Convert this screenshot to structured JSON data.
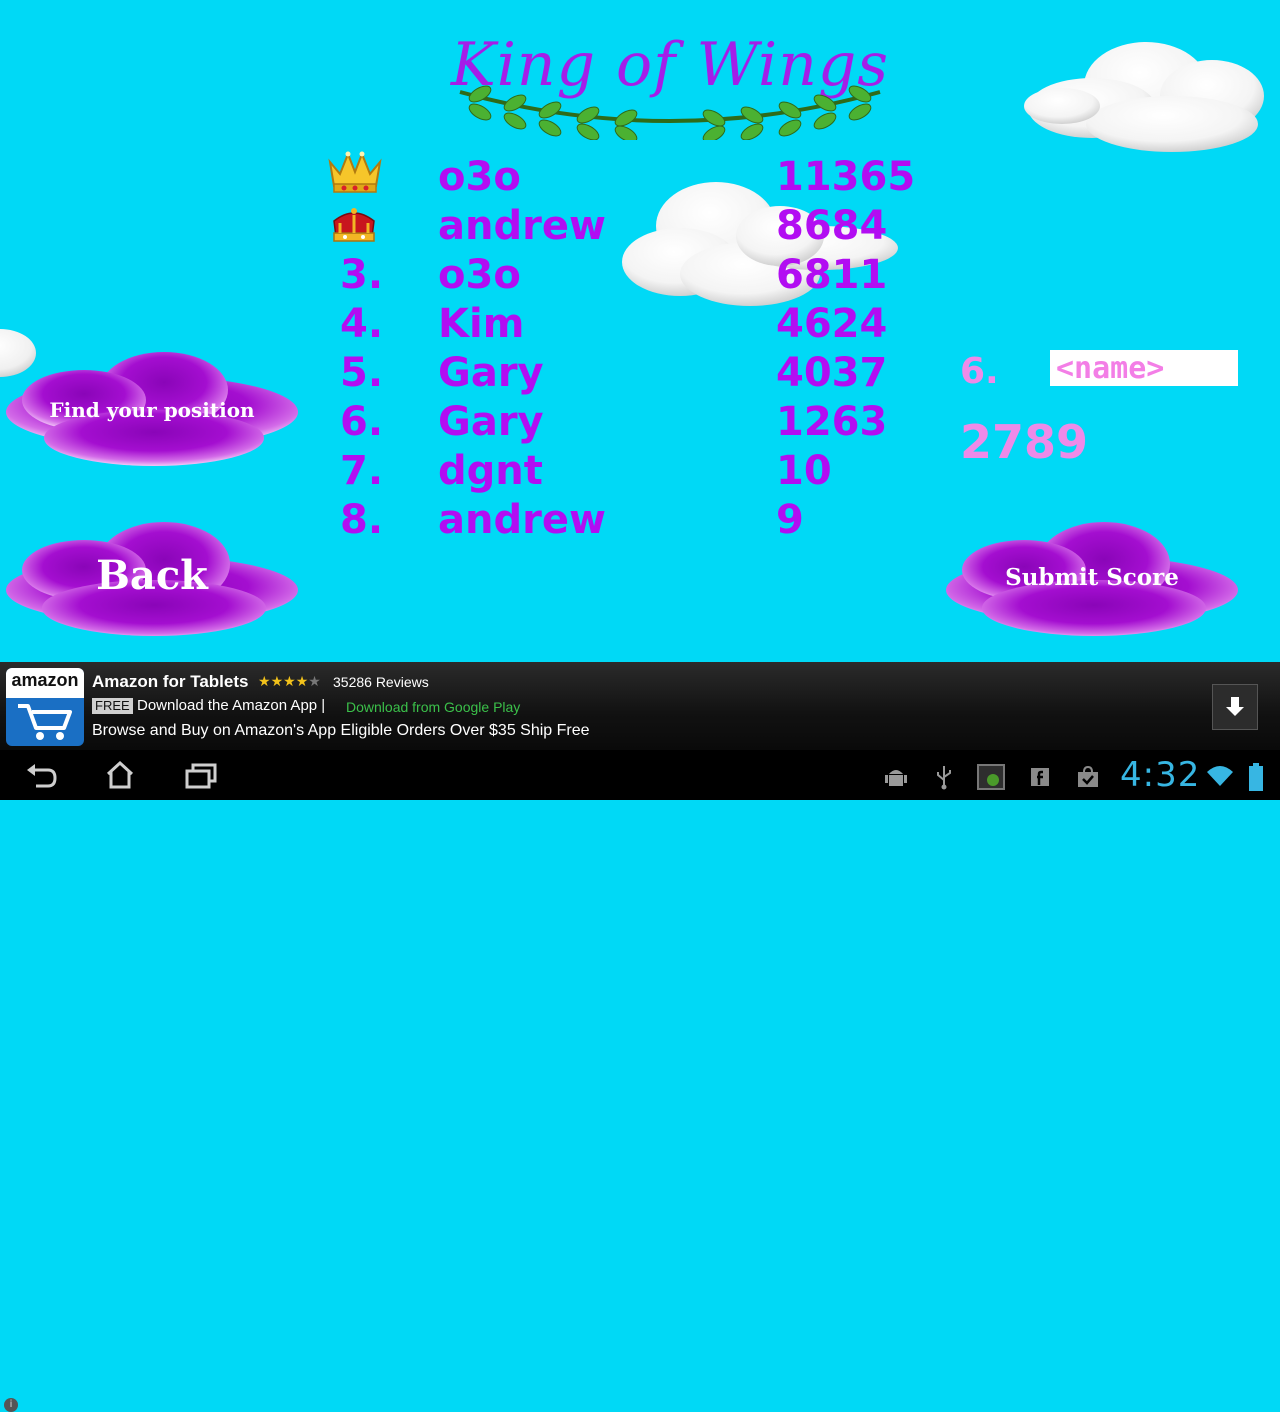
{
  "title": "King of Wings",
  "leaderboard": [
    {
      "rank": "",
      "name": "o3o",
      "score": "11365",
      "crown": "gold-crown-icon"
    },
    {
      "rank": "",
      "name": "andrew",
      "score": "8684",
      "crown": "red-crown-icon"
    },
    {
      "rank": "3.",
      "name": "o3o",
      "score": "6811"
    },
    {
      "rank": "4.",
      "name": "Kim",
      "score": "4624"
    },
    {
      "rank": "5.",
      "name": "Gary",
      "score": "4037"
    },
    {
      "rank": "6.",
      "name": "Gary",
      "score": "1263"
    },
    {
      "rank": "7.",
      "name": "dgnt",
      "score": "10"
    },
    {
      "rank": "8.",
      "name": "andrew",
      "score": "9"
    }
  ],
  "player": {
    "rank": "6.",
    "name_placeholder": "<name>",
    "score": "2789"
  },
  "buttons": {
    "find_position": "Find your position",
    "back": "Back",
    "submit": "Submit Score"
  },
  "colors": {
    "sky": "#00d9f6",
    "purple_text": "#b20df2",
    "pink_text": "#ee8ae8",
    "button_purple": "#a00cc8"
  },
  "ad": {
    "logo": "amazon",
    "title": "Amazon for Tablets",
    "rating_stars": "★★★★★",
    "rating": 4,
    "reviews": "35286 Reviews",
    "free_badge": "FREE",
    "line2": "Download the Amazon App |",
    "store_link": "Download from Google Play",
    "line3": "Browse and Buy on Amazon's App Eligible Orders Over $35 Ship Free"
  },
  "system_bar": {
    "time": "4:32"
  }
}
